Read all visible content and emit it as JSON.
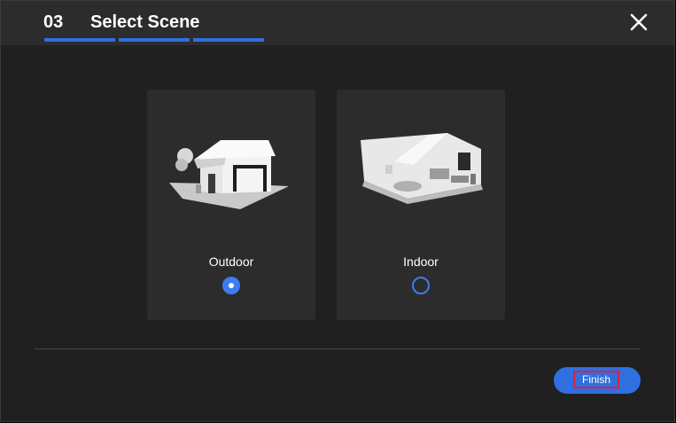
{
  "header": {
    "step": "03",
    "title": "Select Scene",
    "close_icon": "close-icon"
  },
  "progress": {
    "total_steps": 3,
    "completed_steps": 3
  },
  "scenes": [
    {
      "label": "Outdoor",
      "icon": "house-icon",
      "selected": true
    },
    {
      "label": "Indoor",
      "icon": "room-icon",
      "selected": false
    }
  ],
  "footer": {
    "finish_label": "Finish"
  },
  "colors": {
    "accent": "#2f6fe0",
    "background": "#202020",
    "card": "#2c2c2c",
    "highlight": "#e0203a"
  }
}
